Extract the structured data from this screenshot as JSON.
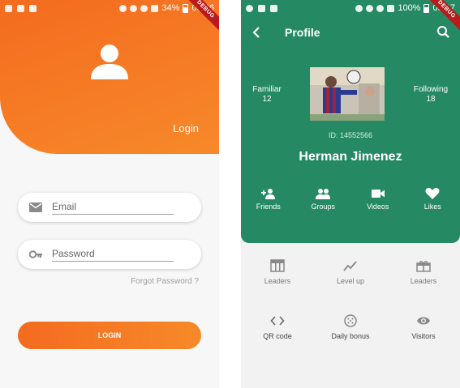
{
  "login_screen": {
    "statusbar": {
      "battery": "34%",
      "time": "03:06"
    },
    "debug_banner": "DEBUG",
    "title": "Login",
    "email_placeholder": "Email",
    "password_placeholder": "Password",
    "forgot_password": "Forgot Password ?",
    "login_button": "LOGIN",
    "colors": {
      "accent_start": "#f46b1f",
      "accent_end": "#f7892a",
      "background": "#f7f7f7"
    },
    "icons": [
      "person-icon",
      "email-icon",
      "key-icon"
    ]
  },
  "profile_screen": {
    "statusbar": {
      "battery": "100%",
      "time": "03:17"
    },
    "debug_banner": "DEBUG",
    "title": "Profile",
    "stats": {
      "familiar_label": "Familiar",
      "familiar_value": "12",
      "following_label": "Following",
      "following_value": "18"
    },
    "user_id": "ID: 14552566",
    "user_name": "Herman Jimenez",
    "actions": [
      {
        "label": "Friends",
        "icon": "group-add-icon"
      },
      {
        "label": "Groups",
        "icon": "group-icon"
      },
      {
        "label": "Videos",
        "icon": "videocam-icon"
      },
      {
        "label": "Likes",
        "icon": "heart-icon"
      }
    ],
    "menu": [
      {
        "label": "Leaders",
        "icon": "leaderboard-icon"
      },
      {
        "label": "Level up",
        "icon": "trending-icon"
      },
      {
        "label": "Leaders",
        "icon": "gift-icon"
      },
      {
        "label": "QR code",
        "icon": "code-icon"
      },
      {
        "label": "Daily bonus",
        "icon": "dots-circle-icon"
      },
      {
        "label": "Visitors",
        "icon": "eye-icon"
      }
    ],
    "colors": {
      "primary": "#258a63",
      "background": "#f2f2f2"
    }
  }
}
